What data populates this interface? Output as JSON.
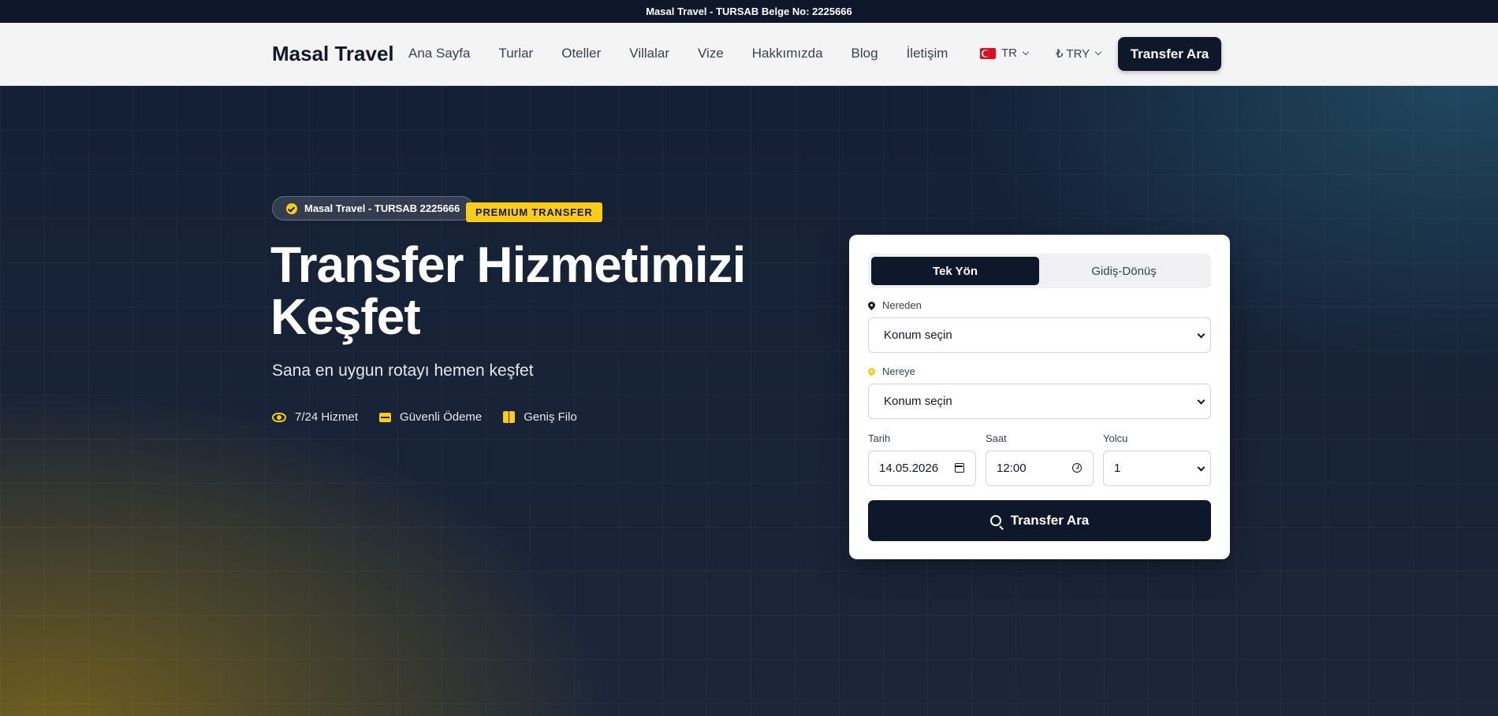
{
  "topbar": {
    "text": "Masal Travel - TURSAB Belge No: 2225666"
  },
  "header": {
    "brand": "Masal Travel",
    "nav": [
      "Ana Sayfa",
      "Turlar",
      "Oteller",
      "Villalar",
      "Vize",
      "Hakkımızda",
      "Blog",
      "İletişim"
    ],
    "language": {
      "code": "TR",
      "icon": "turkey-flag-icon"
    },
    "currency": "₺ TRY",
    "cta_label": "Transfer Ara"
  },
  "hero": {
    "badge": "Masal Travel - TURSAB 2225666",
    "premium_tag": "PREMIUM TRANSFER",
    "title_line1": "Transfer Hizmetimizi",
    "title_line2": "Keşfet",
    "subtitle": "Sana en uygun rotayı hemen keşfet",
    "features": [
      {
        "label": "7/24 Hizmet",
        "icon": "eye-icon"
      },
      {
        "label": "Güvenli Ödeme",
        "icon": "card-icon"
      },
      {
        "label": "Geniş Filo",
        "icon": "box-icon"
      }
    ],
    "accent_color": "#facc15"
  },
  "search": {
    "tabs": [
      "Tek Yön",
      "Gidiş-Dönüş"
    ],
    "active_tab": "Tek Yön",
    "from": {
      "label": "Nereden",
      "value": "Konum seçin"
    },
    "to": {
      "label": "Nereye",
      "value": "Konum seçin"
    },
    "date": {
      "label": "Tarih",
      "value": "14.05.2026"
    },
    "time": {
      "label": "Saat",
      "value": "12:00"
    },
    "passengers": {
      "label": "Yolcu",
      "value": "1"
    },
    "submit_label": "Transfer Ara"
  },
  "colors": {
    "primary": "#0f172a",
    "accent": "#facc15"
  }
}
